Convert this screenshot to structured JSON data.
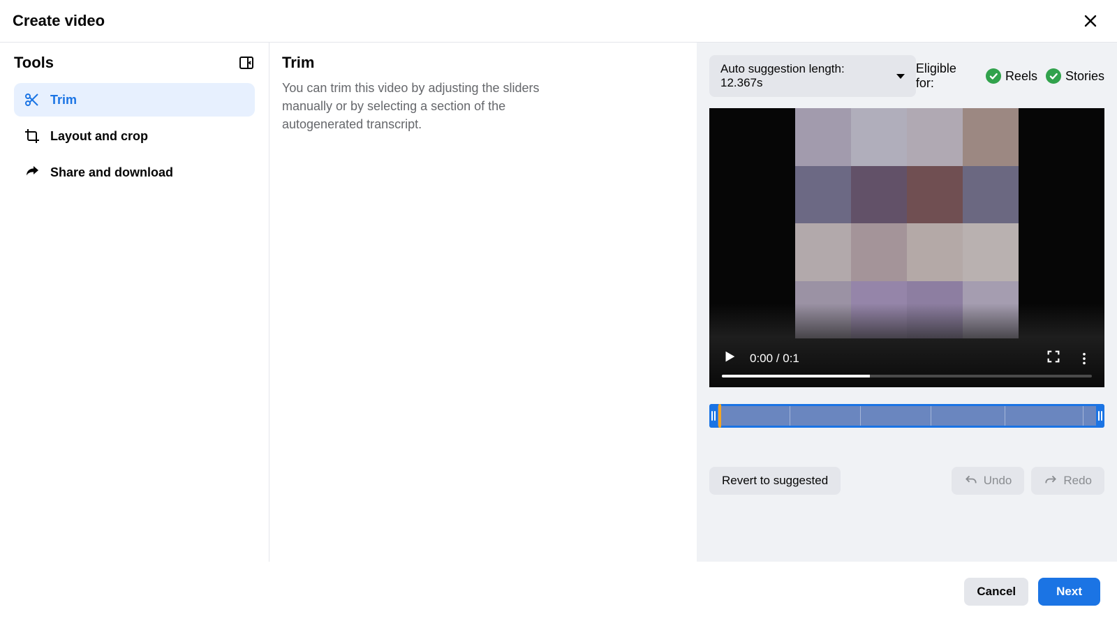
{
  "header": {
    "title": "Create video"
  },
  "sidebar": {
    "title": "Tools",
    "items": [
      {
        "label": "Trim"
      },
      {
        "label": "Layout and crop"
      },
      {
        "label": "Share and download"
      }
    ]
  },
  "info": {
    "title": "Trim",
    "desc": "You can trim this video by adjusting the sliders manually or by selecting a section of the autogenerated transcript."
  },
  "panel": {
    "suggestion_label": "Auto suggestion length: 12.367s",
    "eligible_label": "Eligible for:",
    "eligible": [
      "Reels",
      "Stories"
    ],
    "time": "0:00 / 0:1",
    "revert": "Revert to suggested",
    "undo": "Undo",
    "redo": "Redo"
  },
  "footer": {
    "cancel": "Cancel",
    "next": "Next"
  },
  "mosaic": [
    "#a29bad",
    "#b0aebb",
    "#b0a9b3",
    "#9c8882",
    "#6c6984",
    "#625168",
    "#704f52",
    "#6b6881",
    "#b2a9ab",
    "#a49499",
    "#b4a9a7",
    "#b9b1b0",
    "#9b92a4",
    "#9585a9",
    "#8d7ea1",
    "#a59db0"
  ],
  "timeline_segments_pct": [
    20,
    38,
    56,
    75,
    95
  ]
}
